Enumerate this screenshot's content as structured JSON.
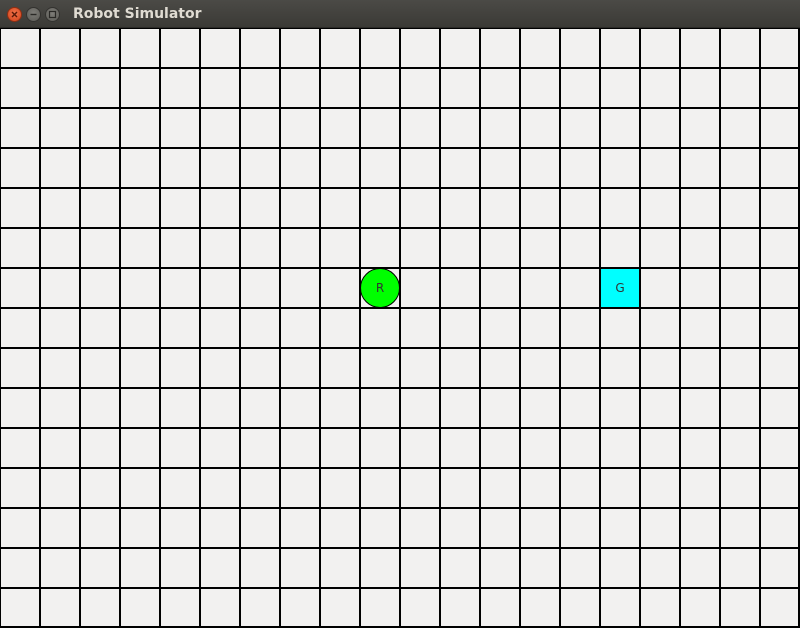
{
  "window": {
    "title": "Robot Simulator"
  },
  "grid": {
    "columns": 20,
    "rows": 15,
    "line_color": "#000000",
    "background_color": "#f2f1f0"
  },
  "robot": {
    "label": "R",
    "column": 9,
    "row": 6,
    "color": "#00ff00"
  },
  "goal": {
    "label": "G",
    "column": 15,
    "row": 6,
    "color": "#00ffff"
  },
  "icons": {
    "close": "close-icon",
    "minimize": "minimize-icon",
    "maximize": "maximize-icon"
  }
}
